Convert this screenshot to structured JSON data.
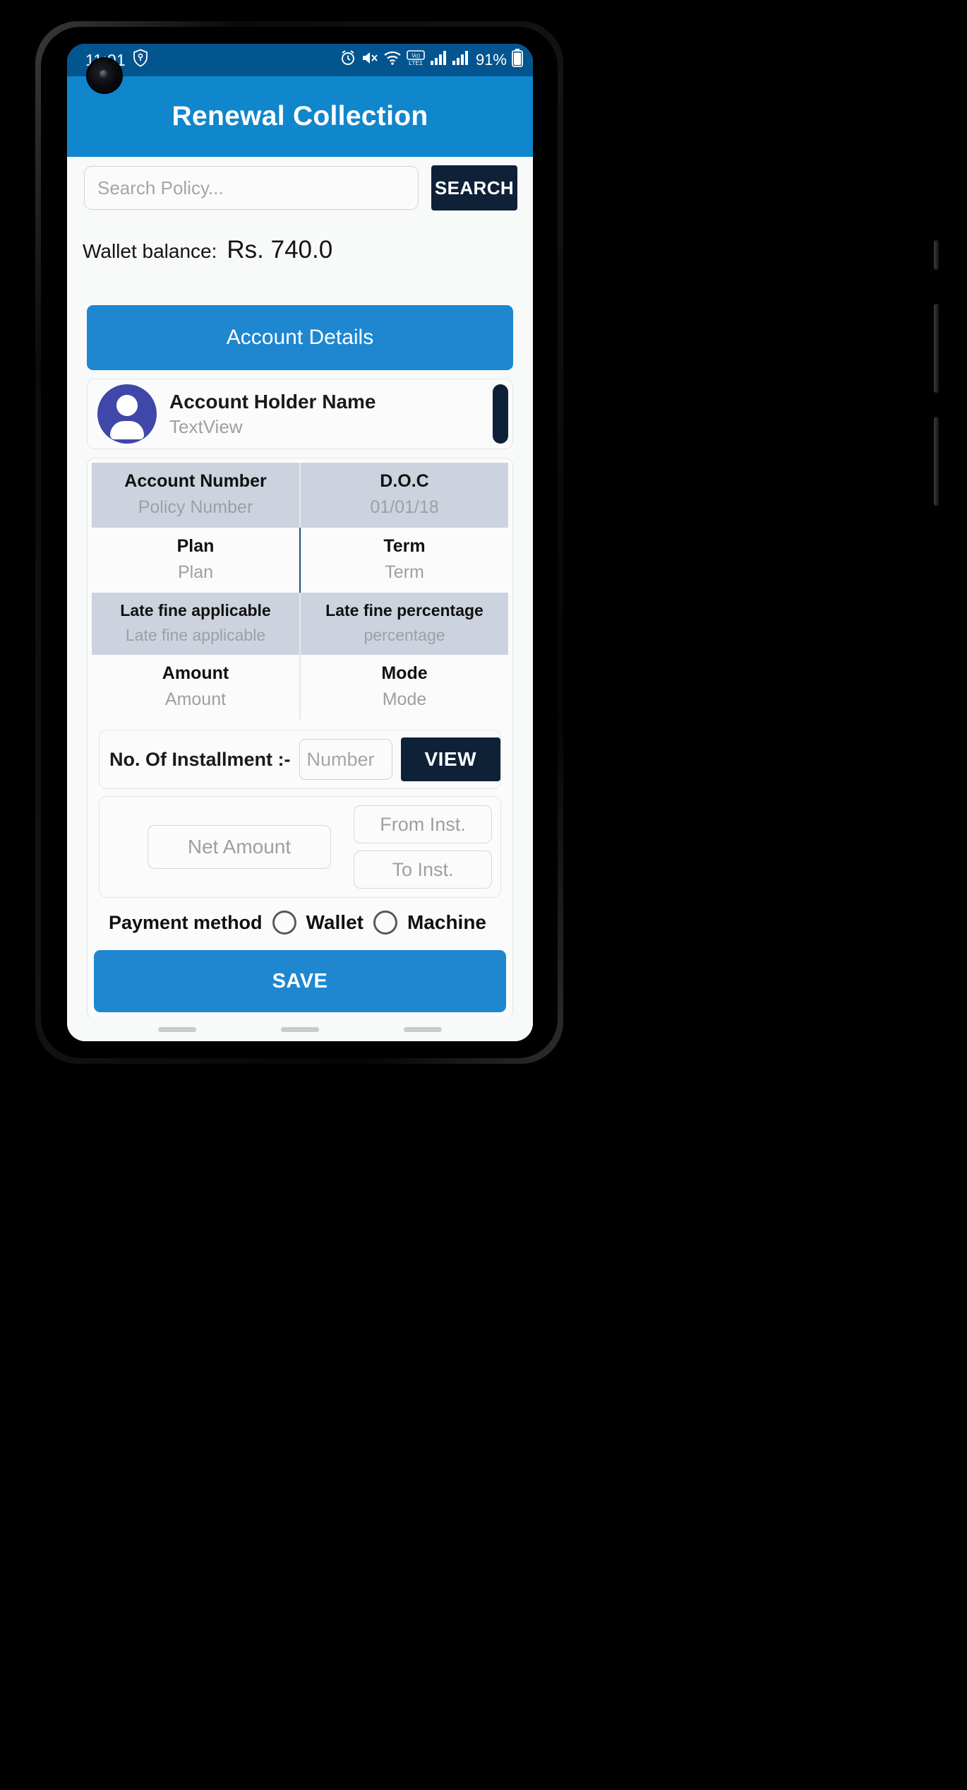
{
  "status_bar": {
    "time": "11:01",
    "left_icons": [
      "shield-key-icon"
    ],
    "right_icons": [
      "alarm-icon",
      "mute-icon",
      "wifi-icon",
      "volte-icon",
      "signal-icon",
      "signal-2-icon"
    ],
    "battery": "91%"
  },
  "appbar": {
    "title": "Renewal Collection"
  },
  "search": {
    "placeholder": "Search Policy...",
    "value": "",
    "button_label": "SEARCH"
  },
  "wallet": {
    "label": "Wallet balance:",
    "value": "Rs. 740.0"
  },
  "account_details_button": {
    "label": "Account Details"
  },
  "holder": {
    "name": "Account Holder Name",
    "subtitle": "TextView"
  },
  "details": [
    {
      "label": "Account Number",
      "value": "Policy Number",
      "shaded": true
    },
    {
      "label": "D.O.C",
      "value": "01/01/18",
      "shaded": true
    },
    {
      "label": "Plan",
      "value": "Plan",
      "shaded": false
    },
    {
      "label": "Term",
      "value": "Term",
      "shaded": false
    },
    {
      "label": "Late fine applicable",
      "value": "Late fine applicable",
      "shaded": true
    },
    {
      "label": "Late fine percentage",
      "value": "percentage",
      "shaded": true
    },
    {
      "label": "Amount",
      "value": "Amount",
      "shaded": false
    },
    {
      "label": "Mode",
      "value": "Mode",
      "shaded": false
    }
  ],
  "installment": {
    "label": "No. Of Installment :-",
    "number_placeholder": "Number",
    "number_value": "",
    "view_label": "VIEW"
  },
  "amounts": {
    "net_placeholder": "Net Amount",
    "net_value": "",
    "from_placeholder": "From Inst.",
    "from_value": "",
    "to_placeholder": "To Inst.",
    "to_value": ""
  },
  "payment": {
    "label": "Payment method",
    "options": [
      {
        "label": "Wallet",
        "selected": false
      },
      {
        "label": "Machine",
        "selected": false
      }
    ]
  },
  "save_button": {
    "label": "SAVE"
  },
  "colors": {
    "status_bar": "#03558f",
    "appbar": "#1086cc",
    "primary_button": "#1e87d0",
    "dark_button": "#0e2137",
    "avatar": "#3f48a8",
    "table_shade": "#ccd3de",
    "page_bg": "#f8f9f9"
  }
}
